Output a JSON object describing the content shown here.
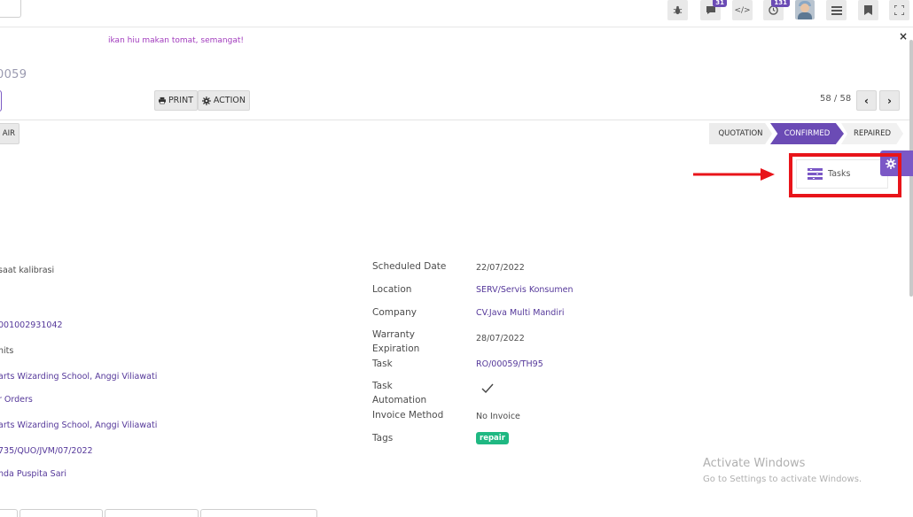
{
  "topbar": {
    "messages_count": "31",
    "activity_count": "131",
    "debug_label": "</>"
  },
  "motto": "ikan hiu makan tomat, semangat!",
  "record_title": "0059",
  "controls": {
    "print_label": "PRINT",
    "action_label": "ACTION",
    "pager": "58 / 58",
    "repair_label": "AIR"
  },
  "stages": [
    {
      "label": "QUOTATION"
    },
    {
      "label": "CONFIRMED"
    },
    {
      "label": "REPAIRED"
    }
  ],
  "smart_buttons": {
    "tasks_label": "Tasks"
  },
  "left_fields": [
    {
      "value": "saat kalibrasi",
      "link": false
    },
    {
      "value": "001002931042",
      "link": true
    },
    {
      "value": "nits",
      "link": false
    },
    {
      "value": "arts Wizarding School, Anggi Viliawati",
      "link": true
    },
    {
      "value": "r Orders",
      "link": true
    },
    {
      "value": "arts Wizarding School, Anggi Viliawati",
      "link": true
    },
    {
      "value": "735/QUO/JVM/07/2022",
      "link": true
    },
    {
      "value": "nda Puspita Sari",
      "link": true
    }
  ],
  "right_fields": {
    "scheduled_date": {
      "label": "Scheduled Date",
      "value": "22/07/2022"
    },
    "location": {
      "label": "Location",
      "value": "SERV/Servis Konsumen"
    },
    "company": {
      "label": "Company",
      "value": "CV.Java Multi Mandiri"
    },
    "warranty": {
      "label": "Warranty Expiration",
      "value": "28/07/2022"
    },
    "task": {
      "label": "Task",
      "value": "RO/00059/TH95"
    },
    "task_automation": {
      "label": "Task Automation",
      "value": "checked"
    },
    "invoice_method": {
      "label": "Invoice Method",
      "value": "No Invoice"
    },
    "tags": {
      "label": "Tags",
      "value": "repair"
    }
  },
  "watermark": {
    "line1": "Activate Windows",
    "line2": "Go to Settings to activate Windows."
  },
  "colors": {
    "accent": "#6b4bb5",
    "link": "#55389a",
    "highlight": "#e8141a",
    "tag": "#1fb882"
  }
}
